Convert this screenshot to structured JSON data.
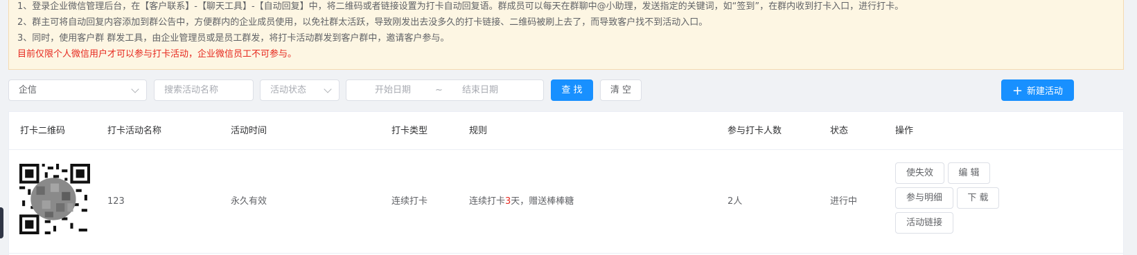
{
  "notice": {
    "lines": [
      "1、登录企业微信管理后台，在【客户联系】-【聊天工具】-【自动回复】中，将二维码或者链接设置为打卡自动回复语。群成员可以每天在群聊中@小助理，发送指定的关键词，如“签到”，在群内收到打卡入口，进行打卡。",
      "2、群主可将自动回复内容添加到群公告中，方便群内的企业成员使用，以免社群太活跃，导致刚发出去没多久的打卡链接、二维码被刷上去了，而导致客户找不到活动入口。",
      "3、同时，使用客户群 群发工具，由企业管理员或是员工群发，将打卡活动群发到客户群中，邀请客户参与。"
    ],
    "warning": "目前仅限个人微信用户才可以参与打卡活动，企业微信员工不可参与。"
  },
  "filters": {
    "source_select": "企信",
    "search_placeholder": "搜索活动名称",
    "status_placeholder": "活动状态",
    "start_date_placeholder": "开始日期",
    "range_separator": "~",
    "end_date_placeholder": "结束日期",
    "search_button": "查 找",
    "clear_button": "清 空",
    "new_button": "新建活动"
  },
  "table": {
    "headers": [
      "打卡二维码",
      "打卡活动名称",
      "活动时间",
      "打卡类型",
      "规则",
      "参与打卡人数",
      "状态",
      "操作"
    ],
    "rows": [
      {
        "name": "123",
        "time": "永久有效",
        "type": "连续打卡",
        "rule_prefix": "连续打卡",
        "rule_days": "3",
        "rule_suffix": "天，赠送棒棒糖",
        "participants": "2人",
        "status": "进行中",
        "actions": {
          "expire": "使失效",
          "edit": "编 辑",
          "details": "参与明细",
          "download": "下 载",
          "link": "活动链接"
        }
      }
    ]
  }
}
